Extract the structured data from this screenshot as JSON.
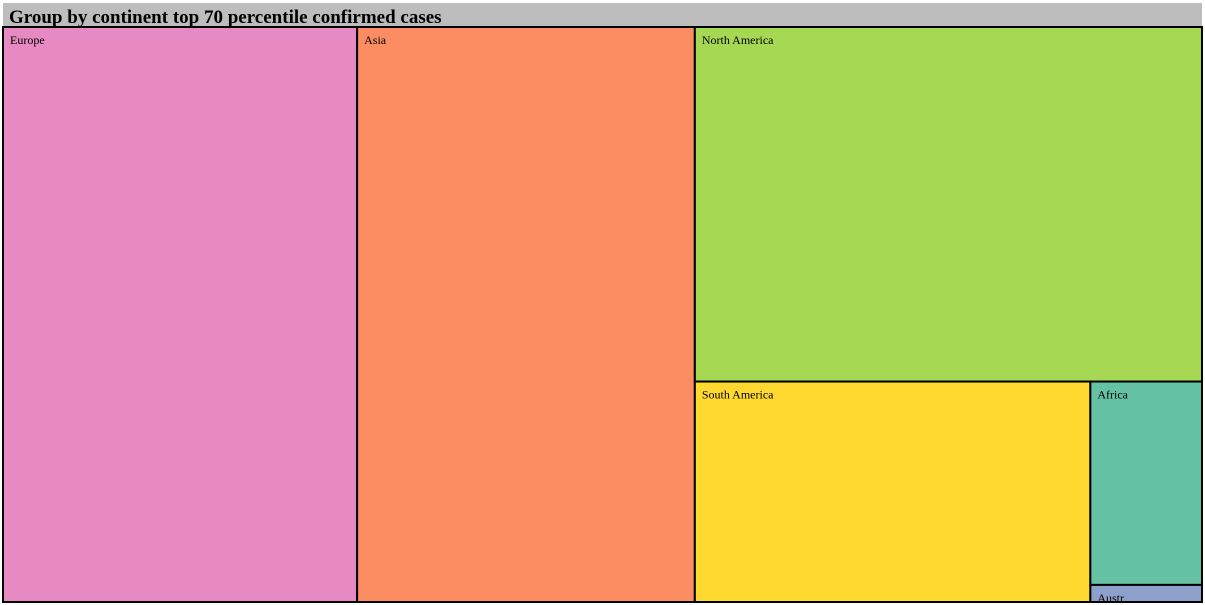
{
  "chart_data": {
    "type": "treemap",
    "title": "Group by continent top 70 percentile confirmed cases",
    "items": [
      {
        "name": "Europe",
        "value": 2027,
        "color": "#e78ac3"
      },
      {
        "name": "Asia",
        "value": 1933,
        "color": "#fc8d62"
      },
      {
        "name": "North America",
        "value": 1790,
        "color": "#a6d854"
      },
      {
        "name": "South America",
        "value": 868,
        "color": "#ffd92f"
      },
      {
        "name": "Africa",
        "value": 226,
        "color": "#66c2a5"
      },
      {
        "name": "Austr",
        "value": 19,
        "color": "#8da0cb"
      }
    ]
  }
}
